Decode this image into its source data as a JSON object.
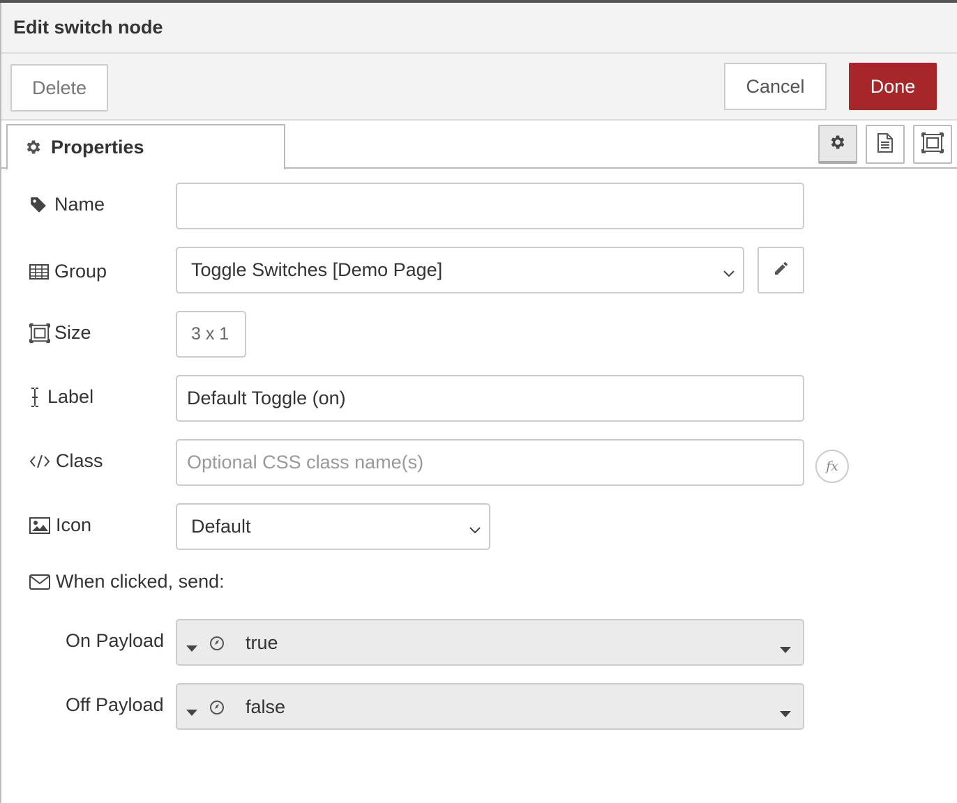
{
  "dialog": {
    "title": "Edit switch node",
    "delete_label": "Delete",
    "cancel_label": "Cancel",
    "done_label": "Done",
    "done_color": "#a6262a"
  },
  "tabs": {
    "properties_label": "Properties",
    "side_icons": [
      "gear-icon",
      "file-text-icon",
      "node-size-icon"
    ]
  },
  "form": {
    "name": {
      "label": "Name",
      "value": "",
      "icon": "tag-icon"
    },
    "group": {
      "label": "Group",
      "value": "Toggle Switches [Demo Page]",
      "icon": "table-icon"
    },
    "size": {
      "label": "Size",
      "value": "3 x 1",
      "icon": "node-size-icon"
    },
    "label": {
      "label": "Label",
      "value": "Default Toggle (on)",
      "icon": "i-cursor-icon"
    },
    "class": {
      "label": "Class",
      "placeholder": "Optional CSS class name(s)",
      "icon": "code-icon",
      "fx_label": "fx"
    },
    "icon": {
      "label": "Icon",
      "value": "Default",
      "icon": "image-icon"
    },
    "send": {
      "label": "When clicked, send:",
      "icon": "envelope-icon"
    },
    "on_payload": {
      "label": "On Payload",
      "value": "true",
      "type_icon": "boolean-icon"
    },
    "off_payload": {
      "label": "Off Payload",
      "value": "false",
      "type_icon": "boolean-icon"
    }
  }
}
